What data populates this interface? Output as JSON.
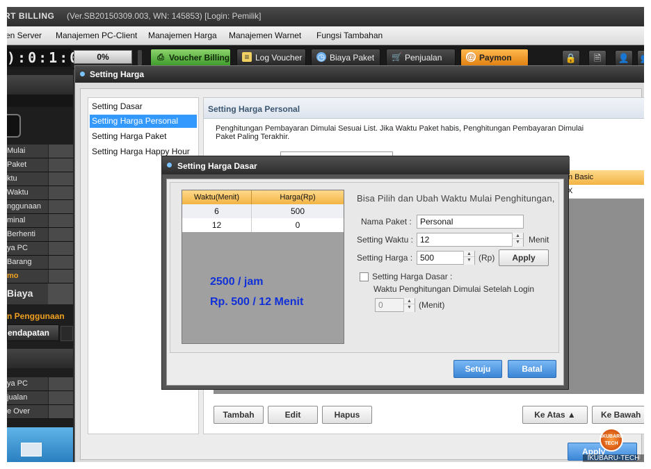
{
  "app": {
    "name": "RT BILLING",
    "version": "(Ver.SB20150309.003, WN: 145853) [Login: Pemilik]"
  },
  "menu": [
    "en Server",
    "Manajemen PC-Client",
    "Manajemen Harga",
    "Manajemen Warnet",
    "Fungsi Tambahan"
  ],
  "toolbar": {
    "timer": "):0:1:0:",
    "progress": "0%",
    "buttons": [
      {
        "label": "Voucher Billing",
        "icon": "printer-icon"
      },
      {
        "label": "Log Voucher",
        "icon": "notes-icon"
      },
      {
        "label": "Biaya Paket",
        "icon": "clock-icon"
      },
      {
        "label": "Penjualan",
        "icon": "cart-icon"
      },
      {
        "label": "Paymon",
        "icon": "paymon-icon"
      }
    ],
    "right_icons": [
      "lock-icon",
      "document-icon",
      "user-icon",
      "users-icon"
    ]
  },
  "sidebar": {
    "rows": [
      "Mulai",
      "Paket",
      "ktu",
      "Waktu",
      "nggunaan",
      "minal",
      "Berhenti",
      "ya PC",
      "Barang",
      "mo"
    ],
    "section_biaya": "Biaya",
    "section_penggunaan": "n Penggunaan",
    "tab_pendapatan": "endapatan",
    "bottom_rows": [
      "ya PC",
      "jualan",
      "e Over"
    ],
    "colors": {
      "accent_text": "#f0a020"
    }
  },
  "window": {
    "title": "Setting Harga",
    "categories": [
      "Setting Dasar",
      "Setting Harga Personal",
      "Setting Harga Paket",
      "Setting Harga Happy Hour"
    ],
    "selected_category": "Setting Harga Personal",
    "panel": {
      "title": "Setting Harga Personal",
      "description": "Penghitungan Pembayaran Dimulai Sesuai List. Jika Waktu Paket habis, Penghitungan Pembayaran Dimulai Paket Paling Terakhir.",
      "column_partial": "n Basic",
      "row1_partial": "X"
    },
    "buttons": {
      "tambah": "Tambah",
      "edit": "Edit",
      "hapus": "Hapus",
      "ke_atas": "Ke Atas ▲",
      "ke_bawah": "Ke Bawah ▼",
      "apply": "Apply"
    }
  },
  "dialog": {
    "title": "Setting Harga Dasar",
    "table": {
      "headers": [
        "Waktu(Menit)",
        "Harga(Rp)"
      ],
      "rows": [
        [
          "6",
          "500"
        ],
        [
          "12",
          "0"
        ]
      ]
    },
    "notes": [
      "2500 / jam",
      "Rp. 500 / 12 Menit"
    ],
    "heading": "Bisa Pilih dan Ubah Waktu Mulai Penghitungan,",
    "fields": {
      "nama_paket_label": "Nama Paket :",
      "nama_paket_value": "Personal",
      "setting_waktu_label": "Setting Waktu :",
      "setting_waktu_value": "12",
      "setting_waktu_unit": "Menit",
      "setting_harga_label": "Setting Harga :",
      "setting_harga_value": "500",
      "setting_harga_unit": "(Rp)",
      "apply_label": "Apply",
      "checkbox_label": "Setting Harga Dasar :",
      "checkbox_checked": false,
      "waktu_login_label": "Waktu Penghitungan Dimulai Setelah Login",
      "waktu_login_value": "0",
      "waktu_login_unit": "(Menit)"
    },
    "buttons": {
      "setuju": "Setuju",
      "batal": "Batal"
    }
  },
  "watermark": {
    "logo_text": "IKUBARU TECH",
    "text": "IKUBARU-TECH Labs"
  }
}
